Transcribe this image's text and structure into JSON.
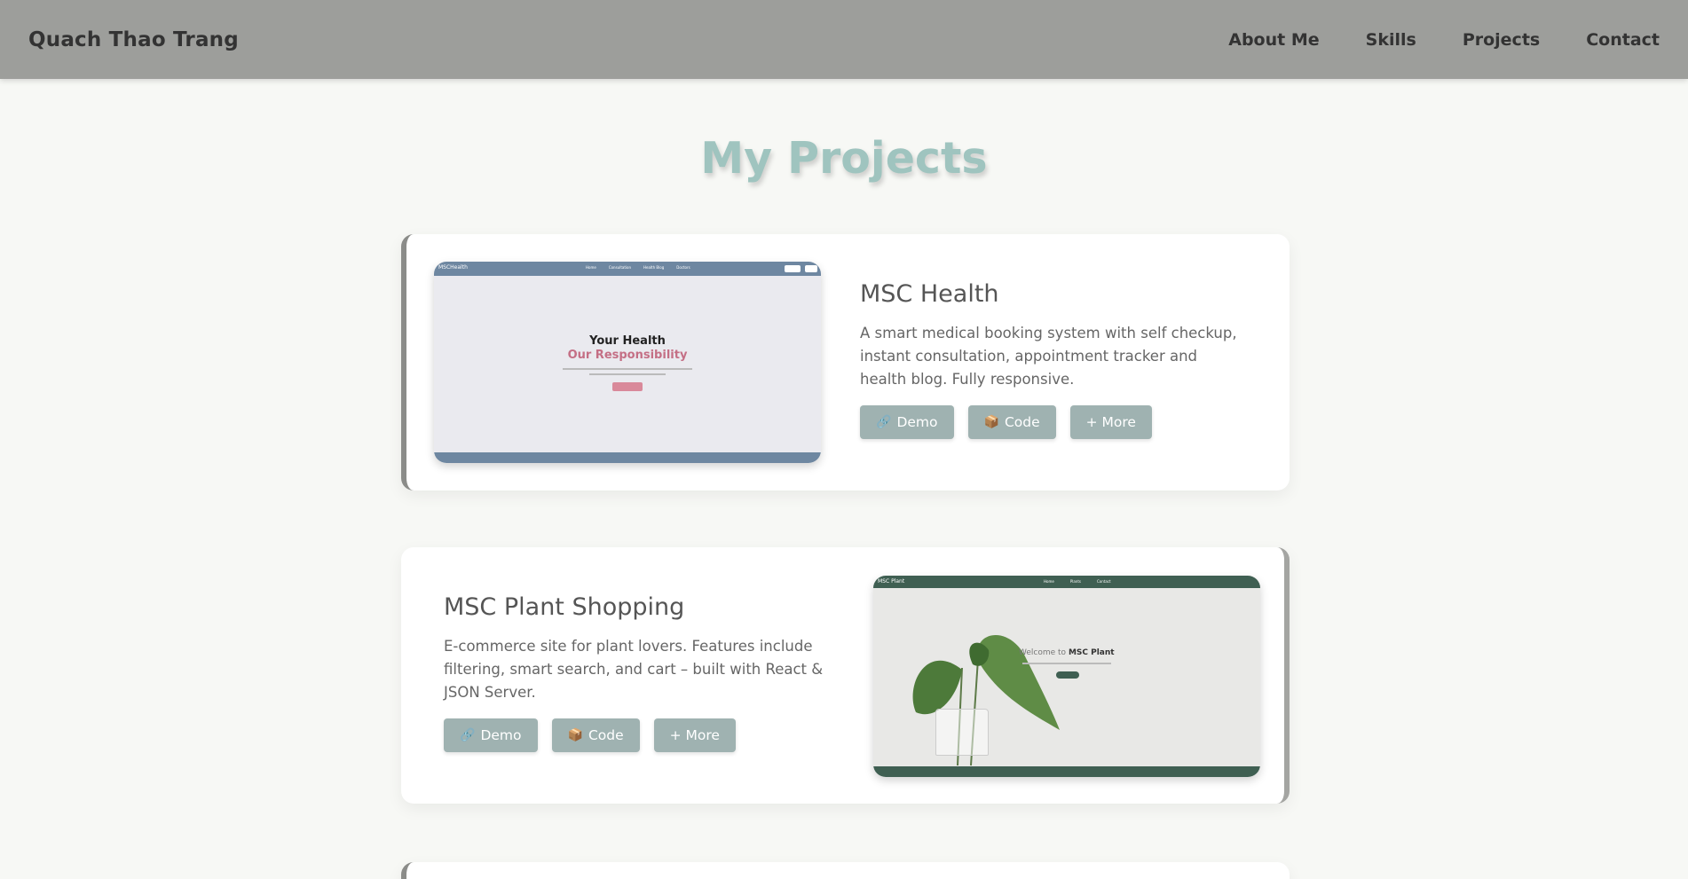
{
  "header": {
    "brand": "Quach Thao Trang",
    "nav": [
      "About Me",
      "Skills",
      "Projects",
      "Contact"
    ]
  },
  "page_title": "My Projects",
  "projects": [
    {
      "title": "MSC Health",
      "description": "A smart medical booking system with self checkup, instant consultation, appointment tracker and health blog. Fully responsive.",
      "buttons": {
        "demo": "Demo",
        "code": "Code",
        "more": "+ More"
      },
      "demo_icon": "🔗",
      "code_icon": "📦",
      "screenshot": {
        "logo": "MSCHealth",
        "links": [
          "Home",
          "Consultation",
          "Health Blog",
          "Doctors"
        ],
        "headline1": "Your Health",
        "headline2": "Our Responsibility"
      }
    },
    {
      "title": "MSC Plant Shopping",
      "description": "E-commerce site for plant lovers. Features include filtering, smart search, and cart – built with React & JSON Server.",
      "buttons": {
        "demo": "Demo",
        "code": "Code",
        "more": "+ More"
      },
      "demo_icon": "🔗",
      "code_icon": "📦",
      "screenshot": {
        "logo": "MSC Plant",
        "links": [
          "Home",
          "Plants",
          "Contact"
        ],
        "welcome_prefix": "Welcome to",
        "welcome_brand": "MSC Plant"
      }
    }
  ],
  "colors": {
    "header_bg": "#9d9e9b",
    "title": "#9fc4bf",
    "button": "#9fb2b1",
    "health_nav": "#6e87a1",
    "plant_nav": "#3f5f52"
  }
}
